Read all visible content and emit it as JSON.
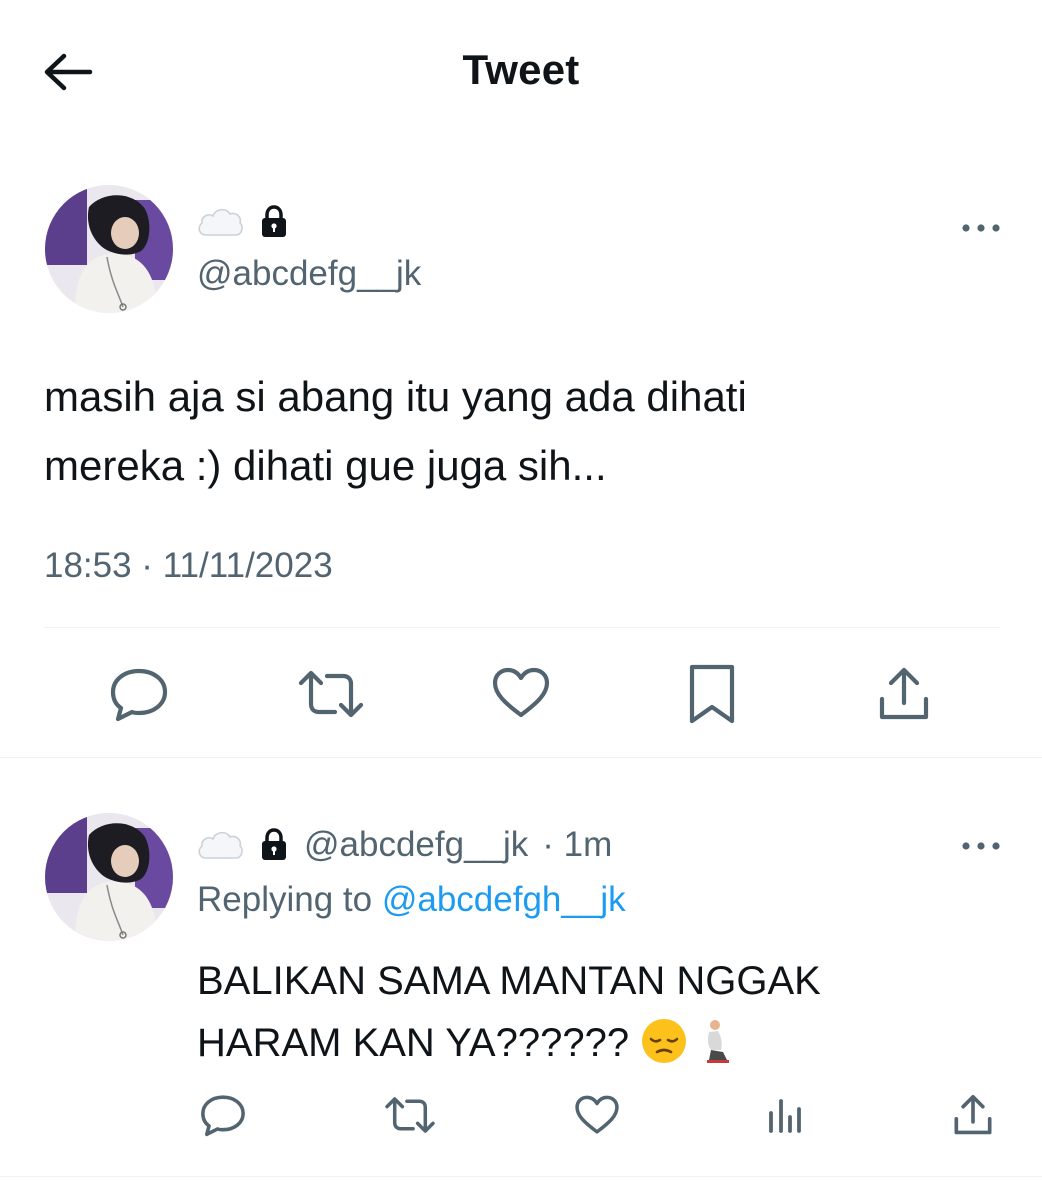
{
  "header": {
    "title": "Tweet"
  },
  "main_tweet": {
    "handle": "@abcdefg__jk",
    "text_line1": "masih aja si abang itu yang ada dihati",
    "text_line2": "mereka :) dihati gue juga sih...",
    "timestamp": "18:53 · 11/11/2023",
    "actions": [
      "reply-icon",
      "retweet-icon",
      "like-icon",
      "bookmark-icon",
      "share-icon"
    ]
  },
  "reply_tweet": {
    "handle": "@abcdefg__jk",
    "time": "· 1m",
    "replying_prefix": "Replying to",
    "replying_to": "@abcdefgh__jk",
    "text_line1": "BALIKAN SAMA MANTAN NGGAK",
    "text_line2": "HARAM KAN YA??????",
    "actions": [
      "reply-icon",
      "retweet-icon",
      "like-icon",
      "views-icon",
      "share-icon"
    ]
  },
  "colors": {
    "text_primary": "#0f1419",
    "text_secondary": "#536471",
    "link": "#1d9bf0",
    "divider": "#eff3f4"
  }
}
